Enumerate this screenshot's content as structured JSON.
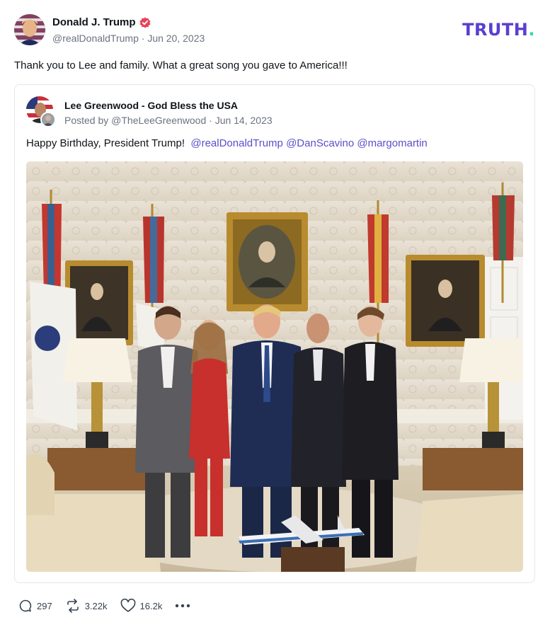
{
  "post": {
    "author_name": "Donald J. Trump",
    "handle": "@realDonaldTrump",
    "date": "Jun 20, 2023",
    "meta_separator": "·",
    "text": "Thank you to Lee and family. What a great song you gave to America!!!"
  },
  "brand": {
    "logo_text": "TRUTH",
    "logo_dot": ".",
    "logo_color": "#5a3fd1",
    "logo_dot_color": "#3ad4b0"
  },
  "quote": {
    "author_name": "Lee Greenwood - God Bless the USA",
    "posted_by_prefix": "Posted by",
    "handle": "@TheLeeGreenwood",
    "date": "Jun 14, 2023",
    "text": "Happy Birthday, President Trump!",
    "mentions": [
      "@realDonaldTrump",
      "@DanScavino",
      "@margomartin"
    ],
    "image_icon": "oval-office-photo"
  },
  "actions": {
    "replies": "297",
    "reposts": "3.22k",
    "likes": "16.2k",
    "reply_icon": "comment-icon",
    "repost_icon": "repost-icon",
    "like_icon": "heart-icon",
    "more_icon": "more-icon"
  },
  "colors": {
    "mention": "#5a4fc8",
    "verified": "#e8445a"
  }
}
